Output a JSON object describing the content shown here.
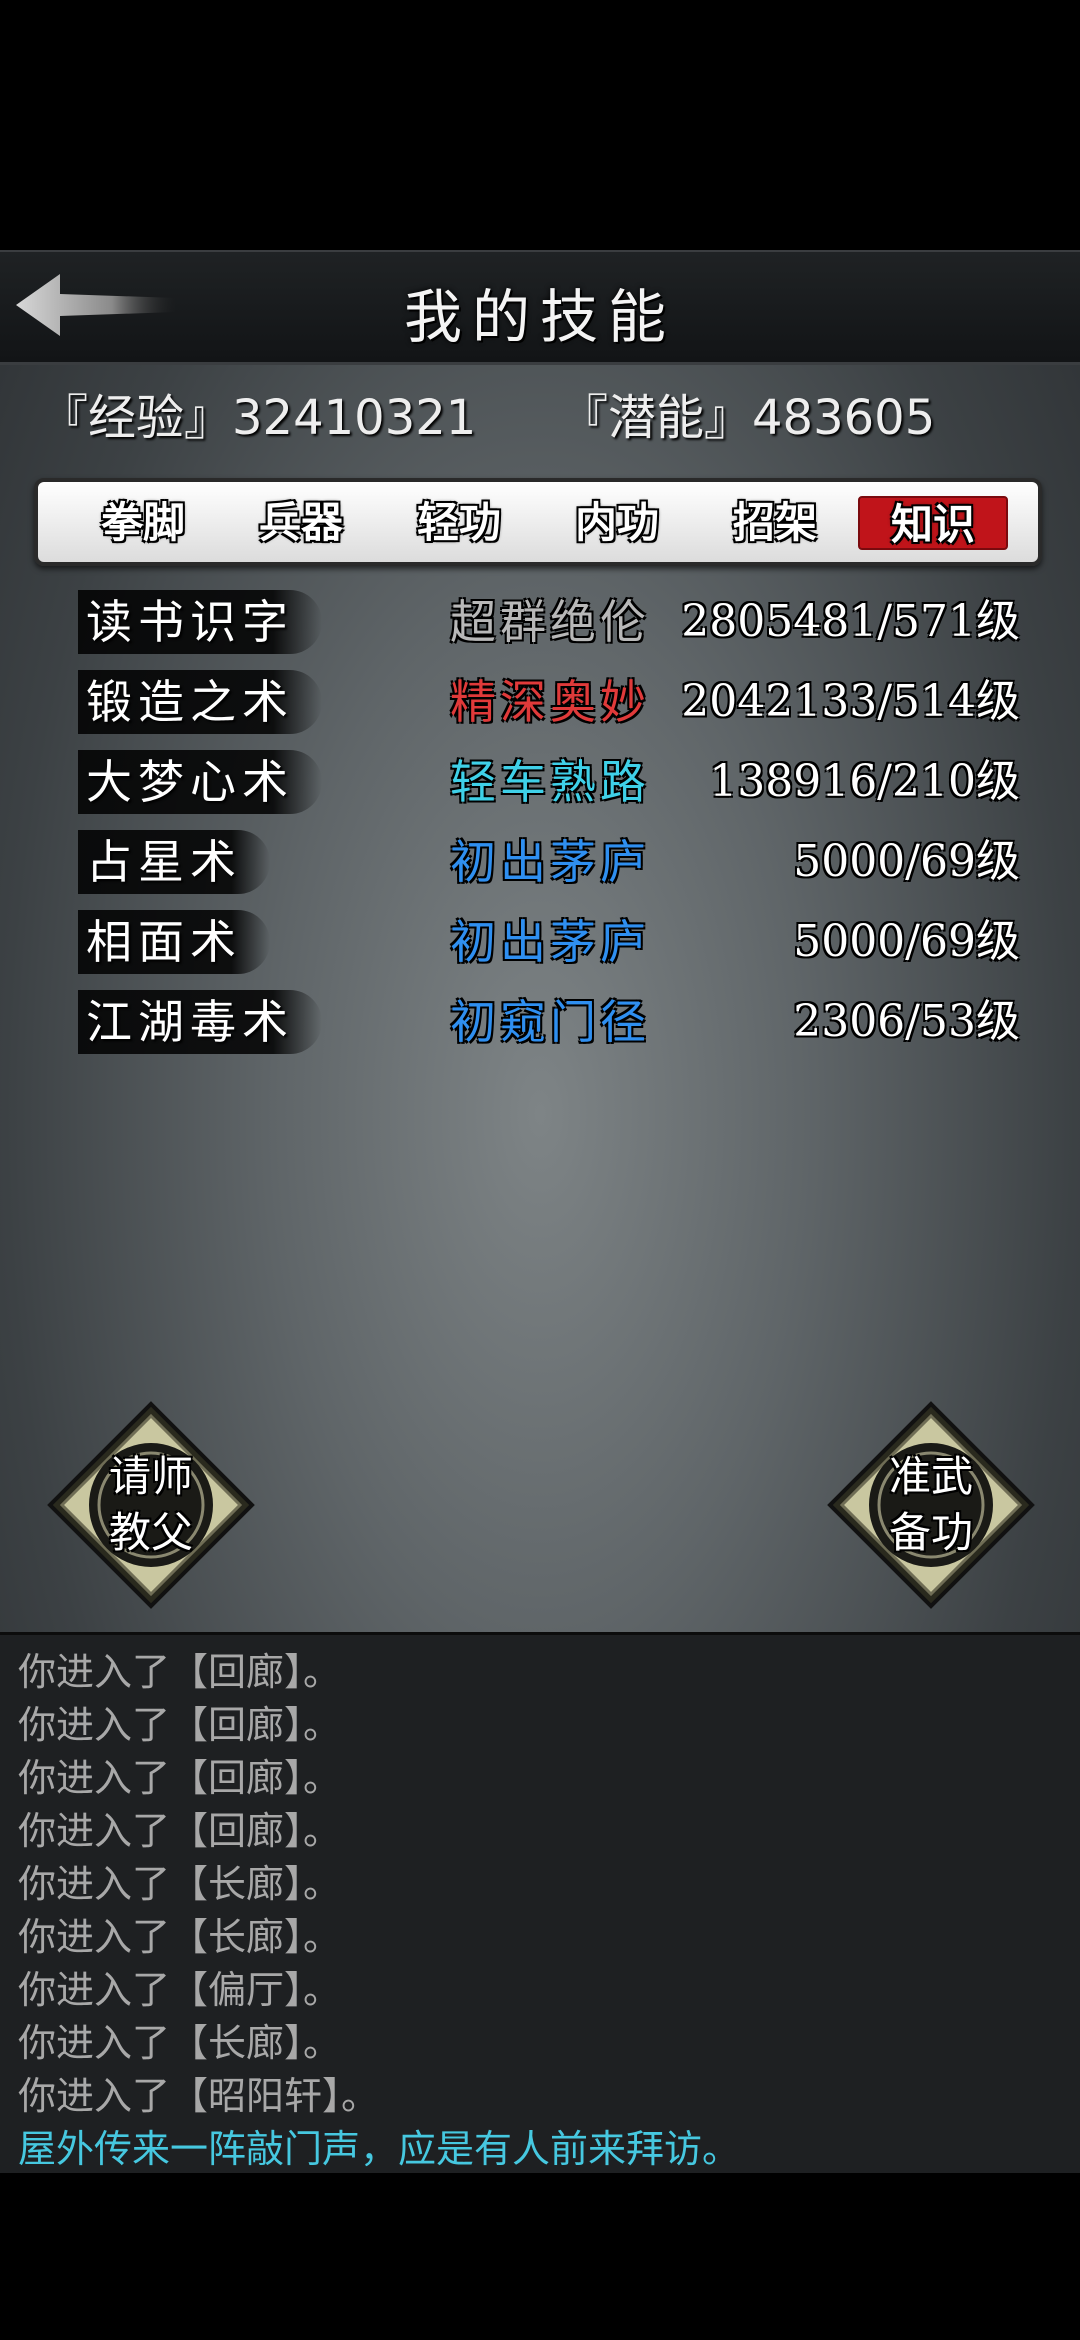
{
  "header": {
    "title": "我的技能",
    "back_icon": "back-arrow-icon"
  },
  "stats": {
    "experience": "『经验』32410321",
    "potential": "『潜能』483605"
  },
  "tabs": [
    {
      "label": "拳脚",
      "active": false
    },
    {
      "label": "兵器",
      "active": false
    },
    {
      "label": "轻功",
      "active": false
    },
    {
      "label": "内功",
      "active": false
    },
    {
      "label": "招架",
      "active": false
    },
    {
      "label": "知识",
      "active": true
    }
  ],
  "skills": [
    {
      "name": "读书识字",
      "rank": "超群绝伦",
      "rank_color": "#b8b8b8",
      "level": "2805481/571级"
    },
    {
      "name": "锻造之术",
      "rank": "精深奥妙",
      "rank_color": "#e03a3a",
      "level": "2042133/514级"
    },
    {
      "name": "大梦心术",
      "rank": "轻车熟路",
      "rank_color": "#3fd0e8",
      "level": "138916/210级"
    },
    {
      "name": "占星术",
      "rank": "初出茅庐",
      "rank_color": "#2f8ff0",
      "level": "5000/69级"
    },
    {
      "name": "相面术",
      "rank": "初出茅庐",
      "rank_color": "#2f8ff0",
      "level": "5000/69级"
    },
    {
      "name": "江湖毒术",
      "rank": "初窥门径",
      "rank_color": "#2f8ff0",
      "level": "2306/53级"
    }
  ],
  "buttons": {
    "left": {
      "line1": "请师",
      "line2": "教父"
    },
    "right": {
      "line1": "准武",
      "line2": "备功"
    }
  },
  "log": [
    {
      "text": "你进入了【回廊】。",
      "highlight": false
    },
    {
      "text": "你进入了【回廊】。",
      "highlight": false
    },
    {
      "text": "你进入了【回廊】。",
      "highlight": false
    },
    {
      "text": "你进入了【回廊】。",
      "highlight": false
    },
    {
      "text": "你进入了【长廊】。",
      "highlight": false
    },
    {
      "text": "你进入了【长廊】。",
      "highlight": false
    },
    {
      "text": "你进入了【偏厅】。",
      "highlight": false
    },
    {
      "text": "你进入了【长廊】。",
      "highlight": false
    },
    {
      "text": "你进入了【昭阳轩】。",
      "highlight": false
    },
    {
      "text": "屋外传来一阵敲门声，应是有人前来拜访。",
      "highlight": true
    }
  ],
  "colors": {
    "active_tab": "#c0141a",
    "highlight_text": "#46c8e0"
  }
}
